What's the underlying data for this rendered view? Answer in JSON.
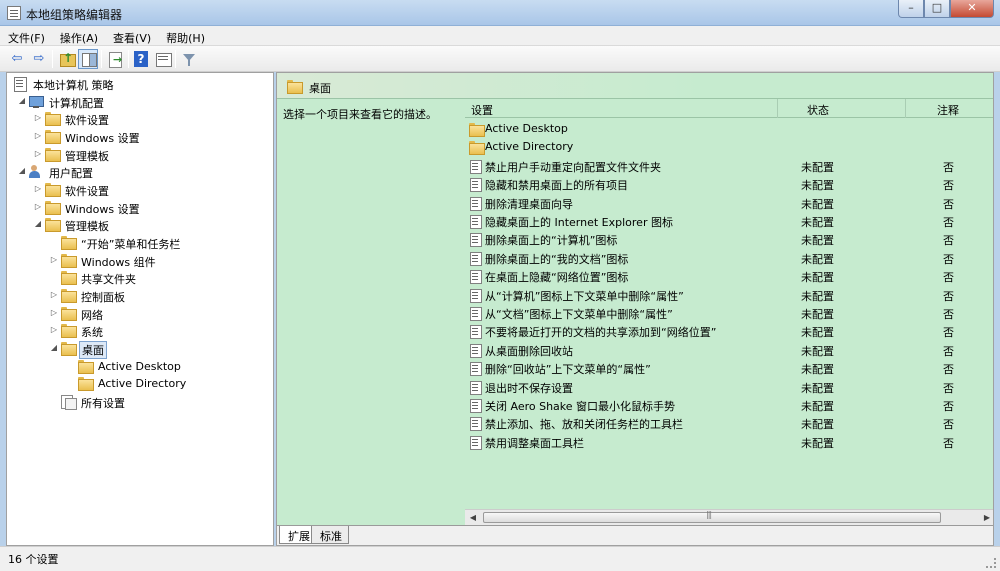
{
  "window": {
    "title": "本地组策略编辑器",
    "min_glyph": "–",
    "max_glyph": "□",
    "close_glyph": "✕"
  },
  "menu": [
    {
      "label": "文件(F)"
    },
    {
      "label": "操作(A)"
    },
    {
      "label": "查看(V)"
    },
    {
      "label": "帮助(H)"
    }
  ],
  "toolbar": {
    "back_glyph": "⇦",
    "forward_glyph": "⇨",
    "help_glyph": "?"
  },
  "tree": {
    "expanded_glyph": "◢",
    "collapsed_glyph": "▷",
    "root": "本地计算机 策略",
    "computer_config": "计算机配置",
    "cc_software": "软件设置",
    "cc_windows": "Windows 设置",
    "cc_admin": "管理模板",
    "user_config": "用户配置",
    "uc_software": "软件设置",
    "uc_windows": "Windows 设置",
    "uc_admin": "管理模板",
    "start_menu": "“开始”菜单和任务栏",
    "win_components": "Windows 组件",
    "shared_folders": "共享文件夹",
    "control_panel": "控制面板",
    "network": "网络",
    "system": "系统",
    "desktop": "桌面",
    "active_desktop": "Active Desktop",
    "active_directory": "Active Directory",
    "all_settings": "所有设置"
  },
  "right_pane": {
    "header_title": "桌面",
    "description": "选择一个项目来查看它的描述。",
    "columns": {
      "setting": "设置",
      "state": "状态",
      "note": "注释"
    },
    "folders": [
      "Active Desktop",
      "Active Directory"
    ],
    "settings": [
      {
        "name": "禁止用户手动重定向配置文件文件夹",
        "state": "未配置",
        "note": "否"
      },
      {
        "name": "隐藏和禁用桌面上的所有项目",
        "state": "未配置",
        "note": "否"
      },
      {
        "name": "删除清理桌面向导",
        "state": "未配置",
        "note": "否"
      },
      {
        "name": "隐藏桌面上的 Internet Explorer 图标",
        "state": "未配置",
        "note": "否"
      },
      {
        "name": "删除桌面上的“计算机”图标",
        "state": "未配置",
        "note": "否"
      },
      {
        "name": "删除桌面上的“我的文档”图标",
        "state": "未配置",
        "note": "否"
      },
      {
        "name": "在桌面上隐藏“网络位置”图标",
        "state": "未配置",
        "note": "否"
      },
      {
        "name": "从“计算机”图标上下文菜单中删除“属性”",
        "state": "未配置",
        "note": "否"
      },
      {
        "name": "从“文档”图标上下文菜单中删除“属性”",
        "state": "未配置",
        "note": "否"
      },
      {
        "name": "不要将最近打开的文档的共享添加到“网络位置”",
        "state": "未配置",
        "note": "否"
      },
      {
        "name": "从桌面删除回收站",
        "state": "未配置",
        "note": "否"
      },
      {
        "name": "删除“回收站”上下文菜单的“属性”",
        "state": "未配置",
        "note": "否"
      },
      {
        "name": "退出时不保存设置",
        "state": "未配置",
        "note": "否"
      },
      {
        "name": "关闭 Aero Shake 窗口最小化鼠标手势",
        "state": "未配置",
        "note": "否"
      },
      {
        "name": "禁止添加、拖、放和关闭任务栏的工具栏",
        "state": "未配置",
        "note": "否"
      },
      {
        "name": "禁用调整桌面工具栏",
        "state": "未配置",
        "note": "否"
      }
    ],
    "scroll_left_glyph": "◀",
    "scroll_right_glyph": "▶"
  },
  "tabs": {
    "extended": "扩展",
    "standard": "标准"
  },
  "status": {
    "text": "16 个设置"
  }
}
